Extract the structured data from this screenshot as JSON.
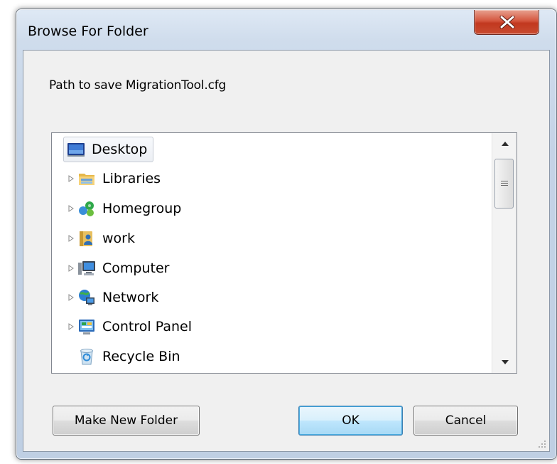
{
  "window": {
    "title": "Browse For Folder",
    "close_glyph": "x"
  },
  "instruction": "Path to save MigrationTool.cfg",
  "tree": {
    "items": [
      {
        "label": "Desktop",
        "icon": "desktop-icon",
        "expander": false,
        "selected": true
      },
      {
        "label": "Libraries",
        "icon": "libraries-icon",
        "expander": true
      },
      {
        "label": "Homegroup",
        "icon": "homegroup-icon",
        "expander": true
      },
      {
        "label": "work",
        "icon": "user-folder-icon",
        "expander": true
      },
      {
        "label": "Computer",
        "icon": "computer-icon",
        "expander": true
      },
      {
        "label": "Network",
        "icon": "network-icon",
        "expander": true
      },
      {
        "label": "Control Panel",
        "icon": "control-panel-icon",
        "expander": true
      },
      {
        "label": "Recycle Bin",
        "icon": "recycle-bin-icon",
        "expander": false
      }
    ]
  },
  "buttons": {
    "new_folder": "Make New Folder",
    "ok": "OK",
    "cancel": "Cancel"
  },
  "colors": {
    "close_red": "#c2381f",
    "default_button_border": "#3c7fb1",
    "frame": "#c4d3e6"
  }
}
